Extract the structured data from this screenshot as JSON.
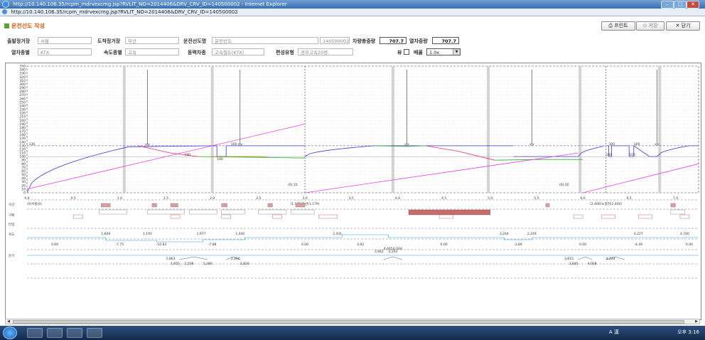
{
  "window": {
    "title": "http://10.140.106.35/rcpm_mdrvexcmg.jsp?RVLIT_NO=2014406&DRV_CRV_ID=140500002 - Internet Explorer",
    "address": "http://10.140.106.35/rcpm_mdrvexcmg.jsp?RVLIT_NO=2014406&DRV_CRV_ID=140500002"
  },
  "page": {
    "title": "운전선도 작성",
    "print_label": "프린트",
    "save_label": "저장",
    "close_label": "닫기"
  },
  "form": {
    "departure_label": "출발정거장",
    "departure_value": "서울",
    "arrival_label": "도착정거장",
    "arrival_value": "부산",
    "curve_label": "운전선도명",
    "curve_value": "운전선도",
    "curve_id": "140500002",
    "vehicle_weight_label": "차량총중량",
    "vehicle_weight_value": "707.7",
    "train_weight_label": "열차중량",
    "train_weight_value": "707.7",
    "train_type_label": "열차종별",
    "train_type_value": "KTX",
    "speed_type_label": "속도종별",
    "speed_type_value": "고속",
    "power_label": "동력차종",
    "power_value": "고속철도(KTX)",
    "formation_label": "편성유형",
    "formation_value": "경부고속20량",
    "view_label": "뷰",
    "zoom_label": "배율",
    "zoom_value": "1.0x"
  },
  "chart_data": {
    "type": "line",
    "y_ticks": [
      "350",
      "340",
      "330",
      "320",
      "310",
      "300",
      "290",
      "280",
      "270",
      "260",
      "250",
      "240",
      "230",
      "220",
      "210",
      "200",
      "190",
      "180",
      "170",
      "160",
      "150",
      "140",
      "130",
      "120",
      "110",
      "100",
      "90",
      "80",
      "70",
      "60",
      "50",
      "40",
      "30",
      "20",
      "10",
      "0"
    ],
    "x_ticks": [
      "0.0",
      "0.5",
      "1.0",
      "1.5",
      "2.0",
      "2.5",
      "3.0",
      "3.5",
      "4.0",
      "4.5",
      "5.0",
      "5.5",
      "6.0",
      "6.5",
      "7.0"
    ],
    "speed_limit_labels": [
      "130",
      "100",
      "100",
      "100",
      "100",
      "100",
      "100",
      "100"
    ],
    "station_labels": [
      "(0)서울(0)",
      "(1,179)용산(1,179)",
      "(2,400)노량진(2,400)"
    ],
    "station_markers": [
      "(0) 10",
      "(0) 20"
    ],
    "track_rows": [
      "곡선",
      "구배",
      "터널",
      "속도",
      "분기"
    ],
    "speed_values": [
      "0.00",
      "-7.75",
      "-10.83",
      "-7.88",
      "0.00",
      "4.92",
      "0.00",
      "-3.89",
      "0.00",
      "-4.49",
      "0.00"
    ],
    "curve_points": [
      "1,609",
      "1,191",
      "1,977",
      "1,440",
      "2,441",
      "3,244",
      "2,244",
      "4,227",
      "4,700"
    ],
    "branch_labels": [
      "1,863",
      "1,655",
      "1,558",
      "1,280",
      "2,466",
      "2,820",
      "4,665",
      "4,044",
      "3,942",
      "4,203",
      "3,615",
      "3,845",
      "4,028",
      "4,244"
    ],
    "series": [
      {
        "name": "",
        "color": "#3a3acc"
      },
      {
        "name": "",
        "color": "#e0306a"
      },
      {
        "name": "",
        "color": "#ea3fe0"
      },
      {
        "name": "",
        "color": "#26b326"
      },
      {
        "name": "",
        "color": "#b98a1a"
      }
    ]
  },
  "tray": {
    "ime": "A 漢",
    "time": "오후 3:16"
  }
}
